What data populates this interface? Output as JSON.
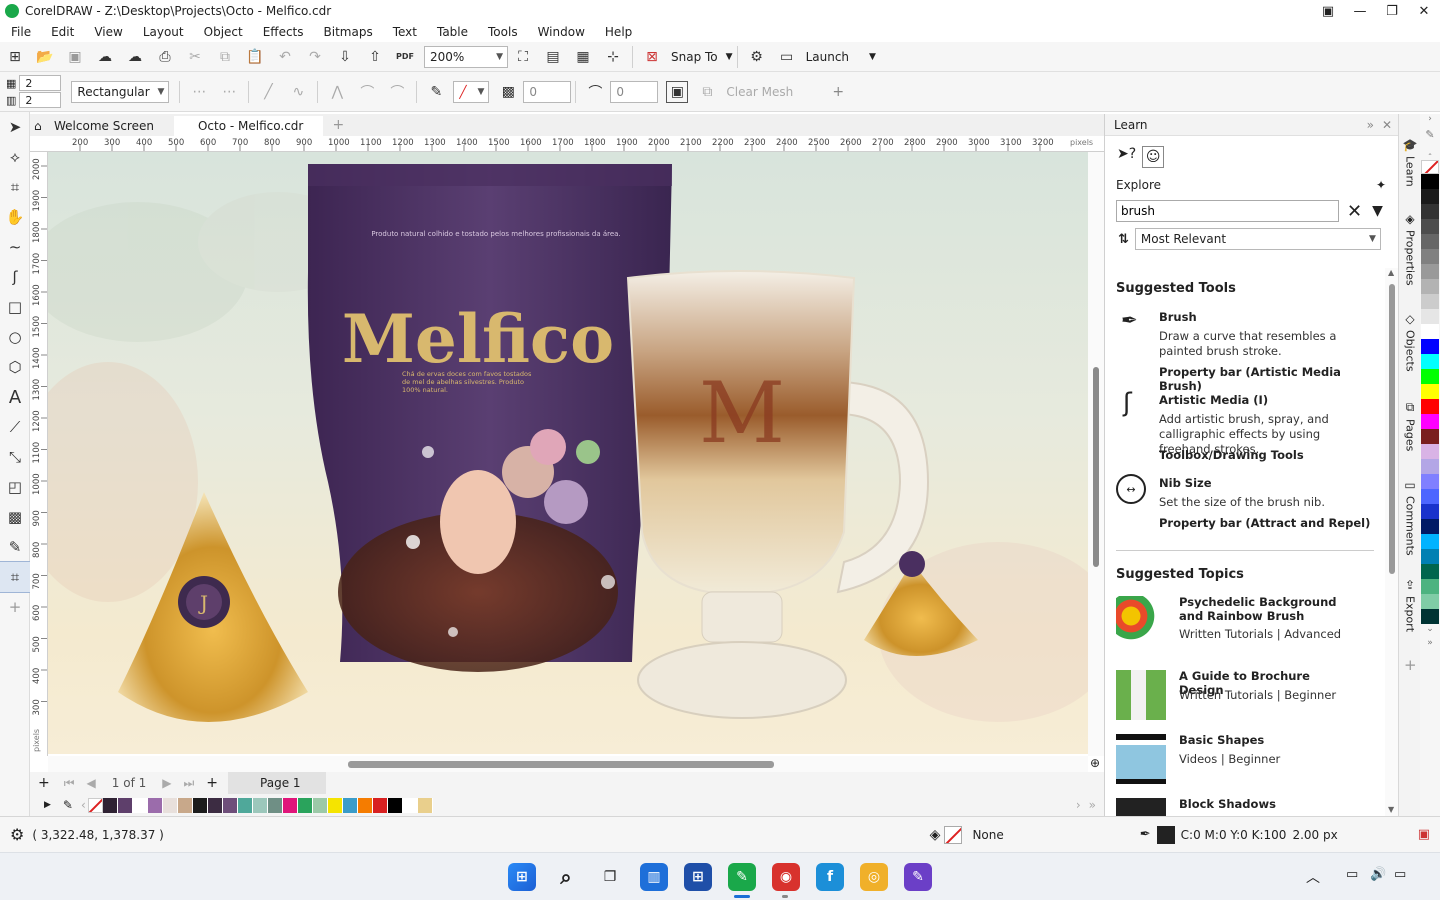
{
  "window": {
    "title": "CorelDRAW - Z:\\Desktop\\Projects\\Octo - Melfico.cdr"
  },
  "menu": [
    "File",
    "Edit",
    "View",
    "Layout",
    "Object",
    "Effects",
    "Bitmaps",
    "Text",
    "Table",
    "Tools",
    "Window",
    "Help"
  ],
  "toolbar": {
    "zoom": "200%",
    "snap_to": "Snap To",
    "launch": "Launch",
    "pdf_label": "PDF"
  },
  "propbar": {
    "rows_value": "2",
    "cols_value": "2",
    "shape_type": "Rectangular",
    "transparency_value": "0",
    "smoothing_value": "0",
    "clear_mesh": "Clear Mesh"
  },
  "tabs": [
    "Welcome Screen",
    "Octo - Melfico.cdr"
  ],
  "ruler": {
    "h_ticks": [
      "200",
      "300",
      "400",
      "500",
      "600",
      "700",
      "800",
      "900",
      "1000",
      "1100",
      "1200",
      "1300",
      "1400",
      "1500",
      "1600",
      "1700",
      "1800",
      "1900",
      "2000",
      "2100",
      "2200",
      "2300",
      "2400",
      "2500",
      "2600",
      "2700",
      "2800",
      "2900",
      "3000",
      "3100",
      "3200"
    ],
    "h_unit": "pixels",
    "v_ticks": [
      "2000",
      "1900",
      "1800",
      "1700",
      "1600",
      "1500",
      "1400",
      "1300",
      "1200",
      "1100",
      "1000",
      "900",
      "800",
      "700",
      "600",
      "500",
      "400",
      "300"
    ],
    "v_unit": "pixels"
  },
  "artwork": {
    "brand": "Melfico",
    "tagline": "Produto natural colhido e tostado pelos melhores profissionais da área.",
    "description": "Chá de ervas doces com favos tostados de mel de abelhas silvestres. Produto 100% natural.",
    "mug_letter": "M",
    "seal_letter": "J"
  },
  "pages": {
    "count": "1 of 1",
    "current": "Page 1"
  },
  "doc_palette": [
    "#2f2233",
    "#5e3f6b",
    "#ffffff",
    "#9b6cab",
    "#e8e0dc",
    "#c8a88a",
    "#1c1c1c",
    "#3c2c42",
    "#6e4e7a",
    "#4fa89a",
    "#9cc7bb",
    "#6f8f85",
    "#e0157a",
    "#2aa35c",
    "#9cc9a8",
    "#f5e400",
    "#3a9cc9",
    "#f57c00",
    "#d82020",
    "#000000",
    "#ffffff",
    "#e9cf8c"
  ],
  "status": {
    "coordinates": "( 3,322.48, 1,378.37 )",
    "fill": "None",
    "outline_color": "C:0 M:0 Y:0 K:100",
    "outline_width": "2.00 px"
  },
  "learn": {
    "title": "Learn",
    "explore": "Explore",
    "search_value": "brush",
    "sort": "Most Relevant",
    "suggested_tools_title": "Suggested Tools",
    "tools": [
      {
        "name": "Brush",
        "desc": "Draw a curve that resembles a painted brush stroke.",
        "link": "Property bar (Artistic Media Brush)"
      },
      {
        "name": "Artistic Media (I)",
        "desc": "Add artistic brush, spray, and calligraphic effects by using freehand strokes.",
        "link": "Toolbox/Drawing Tools"
      },
      {
        "name": "Nib Size",
        "desc": "Set the size of the brush nib.",
        "link": "Property bar (Attract and Repel)"
      }
    ],
    "suggested_topics_title": "Suggested Topics",
    "topics": [
      {
        "title": "Psychedelic Background and Rainbow Brush",
        "type": "Written Tutorials",
        "level": "Advanced"
      },
      {
        "title": "A Guide to Brochure Design",
        "type": "Written Tutorials",
        "level": "Beginner"
      },
      {
        "title": "Basic Shapes",
        "type": "Videos",
        "level": "Beginner"
      },
      {
        "title": "Block Shadows",
        "type": "",
        "level": ""
      }
    ]
  },
  "side_tabs": [
    "Learn",
    "Properties",
    "Objects",
    "Pages",
    "Comments",
    "Export"
  ],
  "right_palette": [
    "#000000",
    "#1a1a1a",
    "#333333",
    "#4d4d4d",
    "#666666",
    "#808080",
    "#999999",
    "#b3b3b3",
    "#cccccc",
    "#e6e6e6",
    "#ffffff",
    "#0000ff",
    "#00ffff",
    "#00ff00",
    "#ffff00",
    "#ff0000",
    "#ff00ff",
    "#7a1f1f",
    "#d9b3e6",
    "#b3a6e6",
    "#8080ff",
    "#4d66ff",
    "#1a33cc",
    "#001a66",
    "#00b3ff",
    "#0080b3",
    "#00664d",
    "#4db380",
    "#80cca6",
    "#003333"
  ]
}
